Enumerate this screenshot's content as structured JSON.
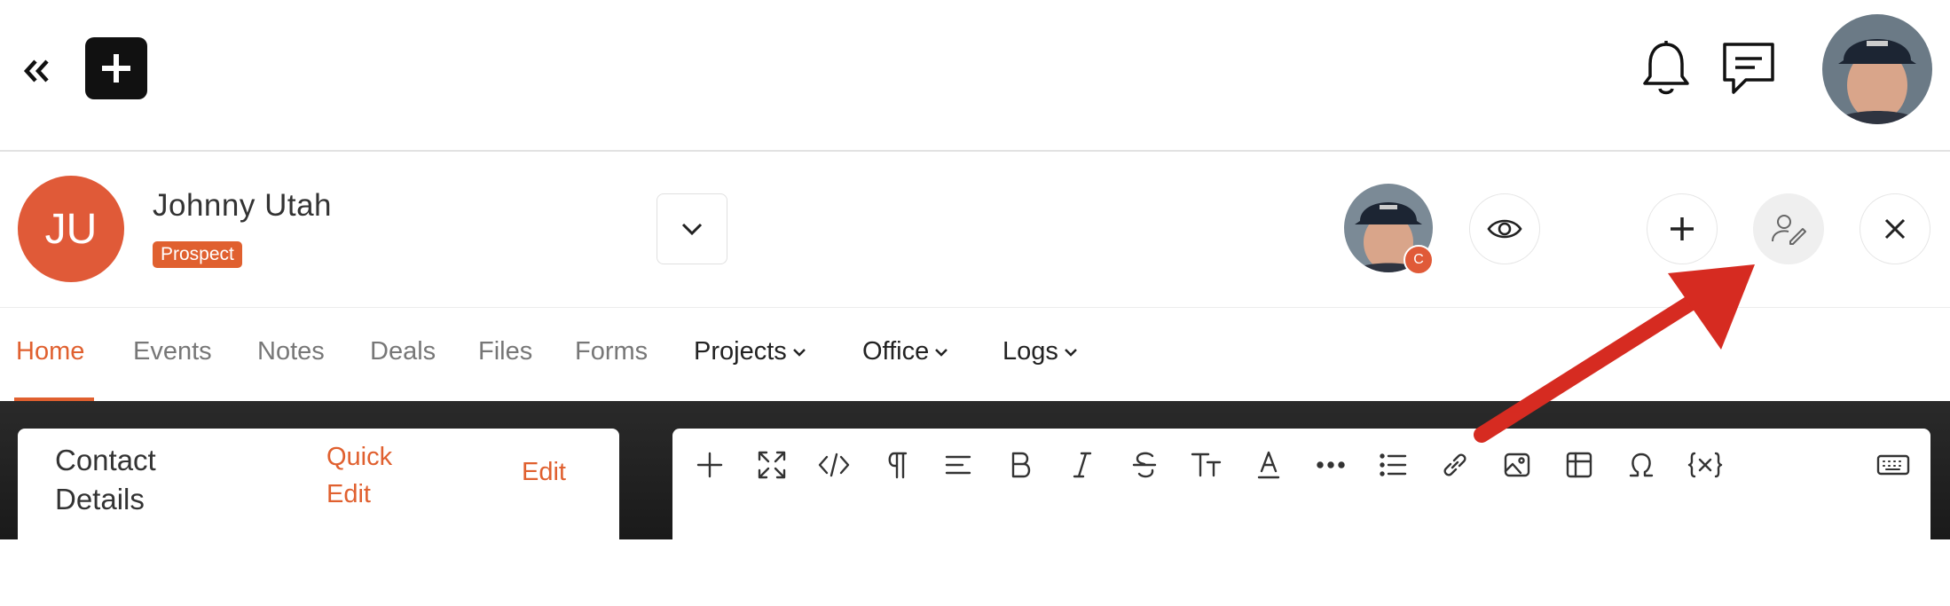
{
  "contact": {
    "initials": "JU",
    "name": "Johnny Utah",
    "status": "Prospect",
    "owner_badge": "C"
  },
  "tabs": [
    {
      "label": "Home"
    },
    {
      "label": "Events"
    },
    {
      "label": "Notes"
    },
    {
      "label": "Deals"
    },
    {
      "label": "Files"
    },
    {
      "label": "Forms"
    },
    {
      "label": "Projects"
    },
    {
      "label": "Office"
    },
    {
      "label": "Logs"
    }
  ],
  "details": {
    "title": "Contact Details",
    "quick_edit": "Quick Edit",
    "edit": "Edit"
  },
  "toolbar_icons": [
    "plus-icon",
    "fullscreen-icon",
    "code-icon",
    "paragraph-icon",
    "align-icon",
    "bold-icon",
    "italic-icon",
    "strikethrough-icon",
    "text-size-icon",
    "font-color-icon",
    "more-icon",
    "list-icon",
    "link-icon",
    "image-icon",
    "table-icon",
    "omega-icon",
    "variable-icon",
    "keyboard-icon"
  ],
  "colors": {
    "accent": "#e0602f",
    "avatar": "#e05a38",
    "annotation_arrow": "#d62b21"
  }
}
